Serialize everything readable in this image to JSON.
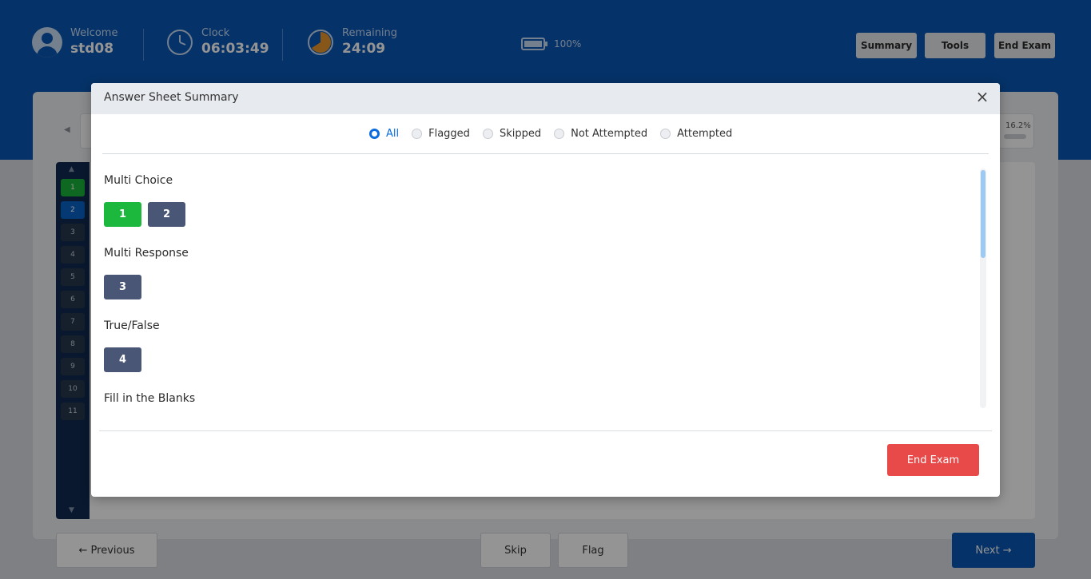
{
  "header": {
    "welcome_label": "Welcome",
    "username": "std08",
    "clock_label": "Clock",
    "clock_value": "06:03:49",
    "remaining_label": "Remaining",
    "remaining_value": "24:09",
    "battery_percent": "100%",
    "buttons": {
      "summary": "Summary",
      "tools": "Tools",
      "end_exam": "End Exam"
    }
  },
  "progress": {
    "percent": "16.2%"
  },
  "question_nav": {
    "numbers": [
      "1",
      "2",
      "3",
      "4",
      "5",
      "6",
      "7",
      "8",
      "9",
      "10",
      "11"
    ],
    "answered": [
      "1"
    ],
    "current": "2"
  },
  "bottom_nav": {
    "previous": "← Previous",
    "skip": "Skip",
    "flag": "Flag",
    "next": "Next →"
  },
  "modal": {
    "title": "Answer Sheet Summary",
    "close_symbol": "×",
    "filters": [
      {
        "label": "All",
        "selected": true
      },
      {
        "label": "Flagged",
        "selected": false
      },
      {
        "label": "Skipped",
        "selected": false
      },
      {
        "label": "Not Attempted",
        "selected": false
      },
      {
        "label": "Attempted",
        "selected": false
      }
    ],
    "sections": [
      {
        "title": "Multi Choice",
        "questions": [
          {
            "num": "1",
            "status": "attempted"
          },
          {
            "num": "2",
            "status": "not-attempted"
          }
        ]
      },
      {
        "title": "Multi Response",
        "questions": [
          {
            "num": "3",
            "status": "not-attempted"
          }
        ]
      },
      {
        "title": "True/False",
        "questions": [
          {
            "num": "4",
            "status": "not-attempted"
          }
        ]
      },
      {
        "title": "Fill in the Blanks",
        "questions": []
      }
    ],
    "end_exam_label": "End Exam"
  },
  "colors": {
    "primary": "#0a56b4",
    "attempted": "#1cb83d",
    "not_attempted": "#4a5675",
    "danger": "#e84a4a",
    "accent": "#0a6ce0"
  }
}
